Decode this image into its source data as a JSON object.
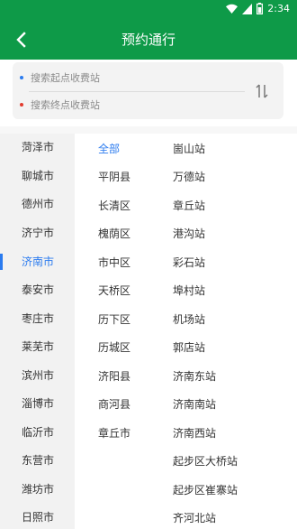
{
  "status_bar": {
    "time": "2:34",
    "icons": [
      "wifi-icon",
      "signal-icon",
      "battery-icon"
    ]
  },
  "header": {
    "title": "预约通行",
    "back_icon": "chevron-left-icon"
  },
  "search": {
    "start_placeholder": "搜索起点收费站",
    "end_placeholder": "搜索终点收费站",
    "swap_icon": "swap-vertical-icon"
  },
  "provinces": [
    "菏泽市",
    "聊城市",
    "德州市",
    "济宁市",
    "济南市",
    "泰安市",
    "枣庄市",
    "莱芜市",
    "滨州市",
    "淄博市",
    "临沂市",
    "东营市",
    "潍坊市",
    "日照市"
  ],
  "selected_province": "济南市",
  "cities": [
    "全部",
    "平阴县",
    "长清区",
    "槐荫区",
    "市中区",
    "天桥区",
    "历下区",
    "历城区",
    "济阳县",
    "商河县",
    "章丘市"
  ],
  "selected_city": "全部",
  "stations": [
    "崮山站",
    "万德站",
    "章丘站",
    "港沟站",
    "彩石站",
    "埠村站",
    "机场站",
    "郭店站",
    "济南东站",
    "济南南站",
    "济南西站",
    "起步区大桥站",
    "起步区崔寨站",
    "齐河北站"
  ],
  "colors": {
    "brand_green": "#0e9a48",
    "accent_blue": "#2b7bef",
    "dot_red": "#e23b2e"
  }
}
